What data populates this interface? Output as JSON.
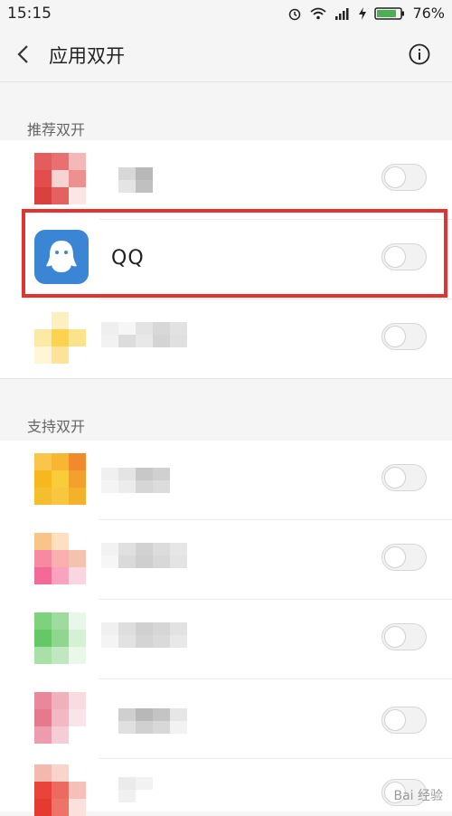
{
  "status_bar": {
    "time": "15:15",
    "battery_percent": "76%",
    "icons": [
      "alarm-icon",
      "wifi-icon",
      "signal-icon",
      "charging-icon",
      "battery-icon"
    ]
  },
  "app_bar": {
    "title": "应用双开",
    "back_icon": "chevron-left-icon",
    "info_icon": "info-icon"
  },
  "sections": {
    "recommended": {
      "header": "推荐双开",
      "apps": [
        {
          "name": "",
          "blurred": true,
          "enabled": false
        },
        {
          "name": "QQ",
          "blurred": false,
          "enabled": false,
          "highlighted": true
        },
        {
          "name": "",
          "blurred": true,
          "enabled": false
        }
      ]
    },
    "supported": {
      "header": "支持双开",
      "apps": [
        {
          "name": "",
          "blurred": true,
          "enabled": false
        },
        {
          "name": "",
          "blurred": true,
          "enabled": false
        },
        {
          "name": "",
          "blurred": true,
          "enabled": false
        },
        {
          "name": "",
          "blurred": true,
          "enabled": false
        },
        {
          "name": "",
          "blurred": true,
          "enabled": false
        }
      ]
    }
  },
  "watermark": "Bai 经验",
  "colors": {
    "highlight_border": "#e33232",
    "qq_icon_bg": "#3b86d4"
  }
}
